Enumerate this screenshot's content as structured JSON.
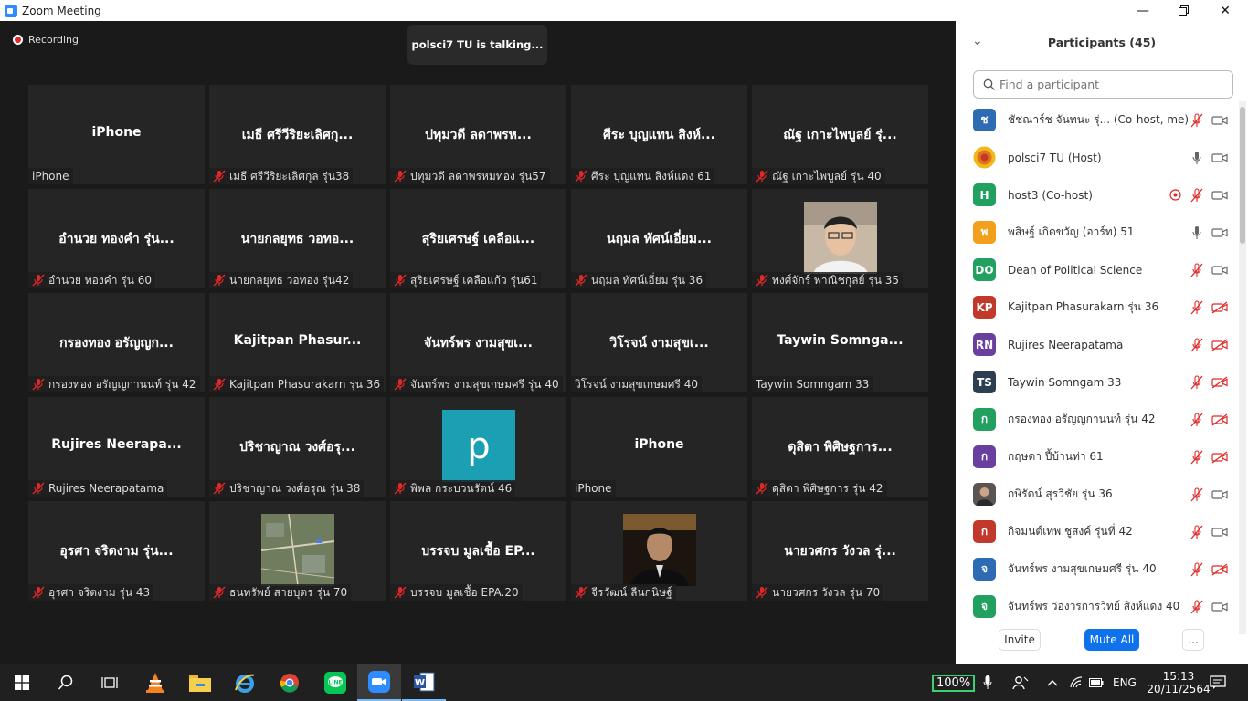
{
  "window": {
    "title": "Zoom Meeting"
  },
  "meeting": {
    "recording_label": "Recording",
    "talking_label": "polsci7 TU is talking...",
    "tiles": [
      {
        "big": "iPhone",
        "footer": "iPhone",
        "muted": false
      },
      {
        "big": "เมธี ศรีวีริยะเลิศกุ...",
        "footer": "เมธี ศรีวีริยะเลิศกุล รุ่น38",
        "muted": true
      },
      {
        "big": "ปทุมวดี ลดาพรห...",
        "footer": "ปทุมวดี ลดาพรหมทอง รุ่น57",
        "muted": true
      },
      {
        "big": "ศีระ บุญแทน สิงห์...",
        "footer": "ศีระ บุญแทน สิงห์แดง 61",
        "muted": true
      },
      {
        "big": "ณัฐ เกาะไพบูลย์ รุ่...",
        "footer": "ณัฐ เกาะไพบูลย์ รุ่น 40",
        "muted": true
      },
      {
        "big": "อำนวย ทองคำ รุ่น...",
        "footer": "อำนวย ทองคำ รุ่น 60",
        "muted": true
      },
      {
        "big": "นายกลยุทธ วอทอ...",
        "footer": "นายกลยุทธ วอทอง รุ่น42",
        "muted": true
      },
      {
        "big": "สุริยเศรษฐ์ เคลือแ...",
        "footer": "สุริยเศรษฐ์ เคลือแก้ว รุ่น61",
        "muted": true
      },
      {
        "big": "นฤมล ทัศน์เอี่ยม...",
        "footer": "นฤมล ทัศน์เอี่ยม รุ่น 36",
        "muted": true
      },
      {
        "big": "",
        "footer": "พงศ์จักร์ พาณิชกุลย์ รุ่น 35",
        "muted": true,
        "photo": "face"
      },
      {
        "big": "กรองทอง อรัญญก...",
        "footer": "กรองทอง อรัญญกานนท์ รุ่น 42",
        "muted": true
      },
      {
        "big": "Kajitpan  Phasur...",
        "footer": "Kajitpan Phasurakarn รุ่น 36",
        "muted": true
      },
      {
        "big": "จันทร์พร งามสุขเ...",
        "footer": "จันทร์พร งามสุขเกษมศรี รุ่น 40",
        "muted": true
      },
      {
        "big": "วิโรจน์    งามสุขเ...",
        "footer": "วิโรจน์    งามสุขเกษมศรี 40",
        "muted": false
      },
      {
        "big": "Taywin  Somnga...",
        "footer": "Taywin Somngam 33",
        "muted": false
      },
      {
        "big": "Rujires  Neerapa...",
        "footer": "Rujires Neerapatama",
        "muted": true
      },
      {
        "big": "ปริชาญาณ วงศ์อรุ...",
        "footer": "ปริชาญาณ วงศ์อรุณ  รุ่น 38",
        "muted": true
      },
      {
        "big": "",
        "footer": "พิพล กระบวนรัตน์ 46",
        "muted": true,
        "photo": "letter",
        "letter": "p"
      },
      {
        "big": "iPhone",
        "footer": "iPhone",
        "muted": false
      },
      {
        "big": "ดุสิตา พิศิษฐการ...",
        "footer": "ดุสิตา พิศิษฐการ รุ่น 42",
        "muted": true
      },
      {
        "big": "อุรศา จริตงาม รุ่น...",
        "footer": "อุรศา จริตงาม รุ่น 43",
        "muted": true
      },
      {
        "big": "",
        "footer": "ธนทรัพย์ สายบุตร รุ่น 70",
        "muted": true,
        "photo": "map"
      },
      {
        "big": "บรรจบ มูลเชื้อ EP...",
        "footer": "บรรจบ มูลเชื้อ EPA.20",
        "muted": true
      },
      {
        "big": "",
        "footer": "จีรวัฒน์ ลีนกนิษฐ์",
        "muted": true,
        "photo": "face2"
      },
      {
        "big": "นายวศกร วังวล รุ่...",
        "footer": "นายวศกร วังวล รุ่น 70",
        "muted": true
      }
    ]
  },
  "panel": {
    "title": "Participants (45)",
    "search_placeholder": "Find a participant",
    "participants": [
      {
        "initials": "ช",
        "name": "ชัชณาร์ช จันทนะ รุ่...  (Co-host, me)",
        "color": "#2d6cb5",
        "mic": "muted",
        "video": "on"
      },
      {
        "initials": "",
        "name": "polsci7 TU (Host)",
        "color": "#f2b81b",
        "mic": "on",
        "video": "on",
        "image": "logo"
      },
      {
        "initials": "H",
        "name": "host3 (Co-host)",
        "color": "#22a060",
        "mic": "muted",
        "video": "on",
        "share": true
      },
      {
        "initials": "พ",
        "name": "พสิษฐ์ เกิดขวัญ (อาร์ท) 51",
        "color": "#f2a01b",
        "mic": "on",
        "video": "on"
      },
      {
        "initials": "DO",
        "name": "Dean of Political Science",
        "color": "#22a060",
        "mic": "muted",
        "video": "on"
      },
      {
        "initials": "KP",
        "name": "Kajitpan Phasurakarn รุ่น 36",
        "color": "#c0392b",
        "mic": "muted",
        "video": "off"
      },
      {
        "initials": "RN",
        "name": "Rujires Neerapatama",
        "color": "#6a3fa0",
        "mic": "muted",
        "video": "off"
      },
      {
        "initials": "TS",
        "name": "Taywin Somngam 33",
        "color": "#2c3e50",
        "mic": "muted",
        "video": "off"
      },
      {
        "initials": "ก",
        "name": "กรองทอง อรัญญกานนท์ รุ่น 42",
        "color": "#22a060",
        "mic": "muted",
        "video": "off"
      },
      {
        "initials": "ก",
        "name": "กฤษดา ปี้บ้านท่า 61",
        "color": "#6a3fa0",
        "mic": "muted",
        "video": "off"
      },
      {
        "initials": "",
        "name": "กษิรัตน์ สุรวิชัย รุ่น 36",
        "color": "#555",
        "mic": "muted",
        "video": "on",
        "image": "photo"
      },
      {
        "initials": "ก",
        "name": "กิจมนต์เทพ ชูสงค์ รุ่นที่ 42",
        "color": "#c0392b",
        "mic": "muted",
        "video": "on"
      },
      {
        "initials": "จ",
        "name": "จันทร์พร งามสุขเกษมศรี รุ่น 40",
        "color": "#2d6cb5",
        "mic": "muted",
        "video": "off"
      },
      {
        "initials": "จ",
        "name": "จันทร์พร ว่องวรการวิทย์ สิงห์แดง 40",
        "color": "#22a060",
        "mic": "muted",
        "video": "on"
      }
    ],
    "invite_label": "Invite",
    "mute_all_label": "Mute All",
    "more_label": "..."
  },
  "taskbar": {
    "zoom_percent": "100%",
    "language": "ENG",
    "time": "15:13",
    "date": "20/11/2564"
  },
  "colors": {
    "accent": "#0e72ed",
    "muted": "#e02828"
  }
}
